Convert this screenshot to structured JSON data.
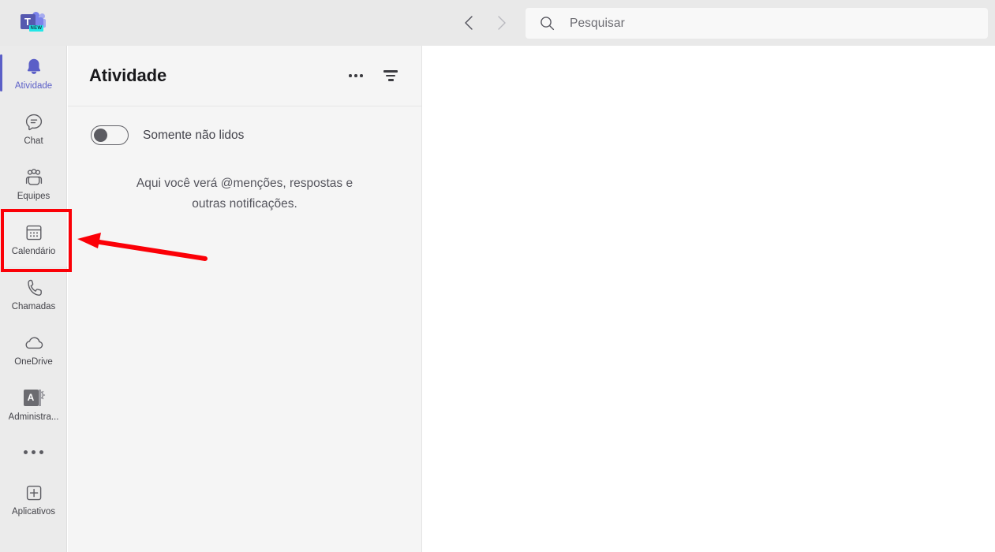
{
  "app": {
    "name": "Microsoft Teams",
    "logo_badge": "NEW"
  },
  "topbar": {
    "back_icon": "chevron-left-icon",
    "forward_icon": "chevron-right-icon",
    "search": {
      "icon": "search-icon",
      "placeholder": "Pesquisar",
      "value": ""
    }
  },
  "sidebar": {
    "items": [
      {
        "id": "atividade",
        "label": "Atividade",
        "icon": "bell-icon",
        "active": true
      },
      {
        "id": "chat",
        "label": "Chat",
        "icon": "chat-bubble-icon",
        "active": false
      },
      {
        "id": "equipes",
        "label": "Equipes",
        "icon": "people-group-icon",
        "active": false
      },
      {
        "id": "calendario",
        "label": "Calendário",
        "icon": "calendar-icon",
        "active": false
      },
      {
        "id": "chamadas",
        "label": "Chamadas",
        "icon": "phone-icon",
        "active": false
      },
      {
        "id": "onedrive",
        "label": "OneDrive",
        "icon": "cloud-icon",
        "active": false
      },
      {
        "id": "administra",
        "label": "Administra...",
        "icon": "admin-gear-icon",
        "active": false
      }
    ],
    "more_label": "more-options",
    "apps": {
      "label": "Aplicativos",
      "icon": "plus-box-icon"
    }
  },
  "panel": {
    "title": "Atividade",
    "more_icon": "ellipsis-icon",
    "filter_icon": "filter-icon",
    "toggle": {
      "label": "Somente não lidos",
      "state": "off"
    },
    "empty_state": "Aqui você verá @menções, respostas e outras notificações."
  },
  "annotation": {
    "highlight_color": "#fb0007",
    "target": "calendario",
    "shape": "rectangle-with-arrow"
  },
  "colors": {
    "accent": "#5b5fc7",
    "topbar_bg": "#e9e9e9",
    "rail_bg": "#ebebeb",
    "panel_bg": "#f5f5f5",
    "annotation_red": "#fb0007"
  }
}
